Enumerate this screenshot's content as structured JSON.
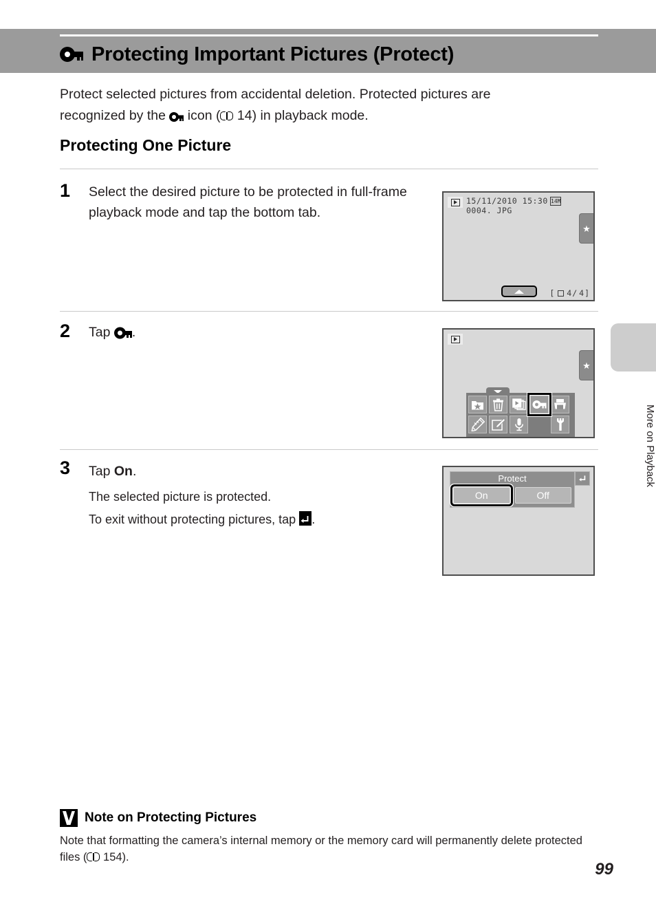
{
  "header": {
    "icon": "key-protect-icon",
    "title": "Protecting Important Pictures (Protect)"
  },
  "intro": {
    "line1": "Protect selected pictures from accidental deletion. Protected pictures are",
    "line2_a": "recognized by the",
    "line2_icon": "protect-key-badge-icon",
    "line2_b": "icon (",
    "line2_book_icon": "book-reference-icon",
    "line2_page": "14",
    "line2_c": ") in playback mode."
  },
  "sub_heading": "Protecting One Picture",
  "steps": [
    {
      "number": "1",
      "text": "Select the desired picture to be protected in full-frame playback mode and tap the bottom tab."
    },
    {
      "number": "2",
      "text_before": "Tap",
      "icon": "key-protect-icon",
      "text_after": "."
    },
    {
      "number": "3",
      "text_before": "Tap",
      "bold": "On",
      "text_after": ".",
      "sub1": "The selected picture is protected.",
      "sub2_before": "To exit without protecting pictures, tap",
      "sub2_icon": "return-back-icon",
      "sub2_after": "."
    }
  ],
  "screens": {
    "step1": {
      "play_badge": "playback-mode-icon",
      "date": "15/11/2010 15:30",
      "filename": "0004. JPG",
      "image_size_badge": "14M",
      "star_tab": "favorites-star-icon",
      "bottom_tab": "chevron-up-icon",
      "counter_prefix": "[",
      "memory_icon": "internal-memory-icon",
      "counter_current": "4/",
      "counter_total": "4]"
    },
    "step2": {
      "play_badge": "playback-mode-icon",
      "star_tab": "favorites-star-icon",
      "handle": "chevron-down-icon",
      "menu_rows": [
        [
          {
            "icon": "favorites-folder-icon",
            "selected": false
          },
          {
            "icon": "delete-trash-icon",
            "selected": false
          },
          {
            "icon": "slideshow-icon",
            "selected": false
          },
          {
            "icon": "protect-key-icon",
            "selected": true
          },
          {
            "icon": "print-order-icon",
            "selected": false
          }
        ],
        [
          {
            "icon": "quick-retouch-pencil-icon",
            "selected": false
          },
          {
            "icon": "edit-image-icon",
            "selected": false
          },
          {
            "icon": "voice-memo-microphone-icon",
            "selected": false
          },
          {
            "icon": "spacer",
            "selected": false
          },
          {
            "icon": "setup-wrench-icon",
            "selected": false
          }
        ]
      ]
    },
    "step3": {
      "dialog_title": "Protect",
      "option_on": "On",
      "option_off": "Off",
      "selected_option": "On",
      "back_button": "return-back-icon"
    }
  },
  "side_tab": {
    "label": "More on Playback"
  },
  "note": {
    "icon": "caution-check-icon",
    "heading": "Note on Protecting Pictures",
    "body_a": "Note that formatting the camera’s internal memory or the memory card will permanently delete protected files (",
    "body_book_icon": "book-reference-icon",
    "body_page": "154",
    "body_b": ")."
  },
  "page_number": "99",
  "colors": {
    "header_band": "#9b9b9b",
    "lcd_bg": "#d9d9d9",
    "lcd_border": "#4d4d4d",
    "menu_panel": "#7d7d7d",
    "side_tab": "#cdcdcd"
  }
}
